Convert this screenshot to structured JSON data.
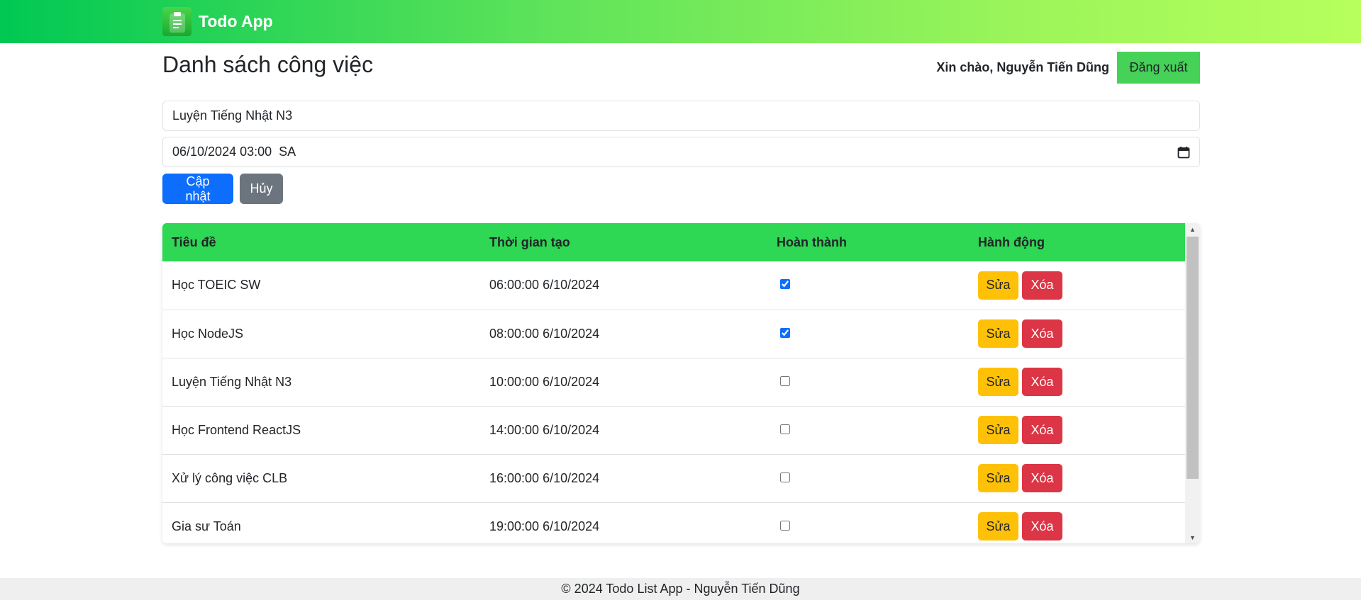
{
  "navbar": {
    "brand": "Todo App",
    "brand_icon": "clipboard-icon"
  },
  "header": {
    "title": "Danh sách công việc",
    "greeting": "Xin chào, Nguyễn Tiến Dũng",
    "logout_label": "Đăng xuất"
  },
  "form": {
    "title_value": "Luyện Tiếng Nhật N3",
    "datetime_value": "06/10/2024 03:00  SA",
    "update_label": "Cập nhật",
    "cancel_label": "Hủy"
  },
  "table": {
    "headers": [
      "Tiêu đề",
      "Thời gian tạo",
      "Hoàn thành",
      "Hành động"
    ],
    "rows": [
      {
        "title": "Học TOEIC SW",
        "created": "06:00:00 6/10/2024",
        "done": true
      },
      {
        "title": "Học NodeJS",
        "created": "08:00:00 6/10/2024",
        "done": true
      },
      {
        "title": "Luyện Tiếng Nhật N3",
        "created": "10:00:00 6/10/2024",
        "done": false
      },
      {
        "title": "Học Frontend ReactJS",
        "created": "14:00:00 6/10/2024",
        "done": false
      },
      {
        "title": "Xử lý công việc CLB",
        "created": "16:00:00 6/10/2024",
        "done": false
      },
      {
        "title": "Gia sư Toán",
        "created": "19:00:00 6/10/2024",
        "done": false
      }
    ],
    "edit_label": "Sửa",
    "delete_label": "Xóa"
  },
  "footer": {
    "text": "© 2024 Todo List App - Nguyễn Tiến Dũng"
  },
  "colors": {
    "navbar_gradient": [
      "#00c853",
      "#b7ff5c"
    ],
    "header_row": "#2ed754",
    "primary": "#0d6efd",
    "secondary": "#6c757d",
    "warning": "#ffc107",
    "danger": "#dc3545",
    "logout": "#46d158"
  }
}
